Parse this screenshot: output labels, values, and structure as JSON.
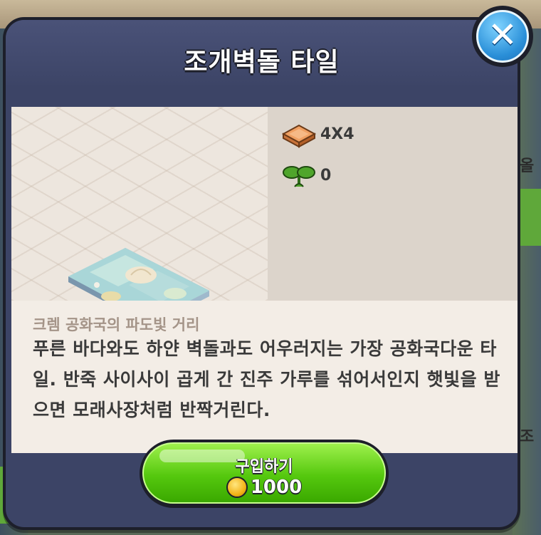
{
  "dialog": {
    "title": "조개벽돌 타일",
    "close_label": "✕"
  },
  "item": {
    "name": "shell-brick-tile",
    "size": "4X4",
    "growth": "0",
    "subtitle": "크렘 공화국의 파도빛 거리",
    "description": "푸른 바다와도 하얀 벽돌과도 어우러지는 가장 공화국다운 타일. 반죽 사이사이 곱게 간 진주 가루를 섞어서인지 햇빛을 받으면 모래사장처럼 반짝거린다."
  },
  "buy": {
    "label": "구입하기",
    "price": "1000",
    "currency_icon": "coin-icon"
  },
  "background": {
    "peek_text_1": "올",
    "peek_text_2": "조"
  },
  "colors": {
    "dialog_bg": "#3c4466",
    "buy_green": "#55c80e",
    "close_blue": "#2a8fd8"
  }
}
